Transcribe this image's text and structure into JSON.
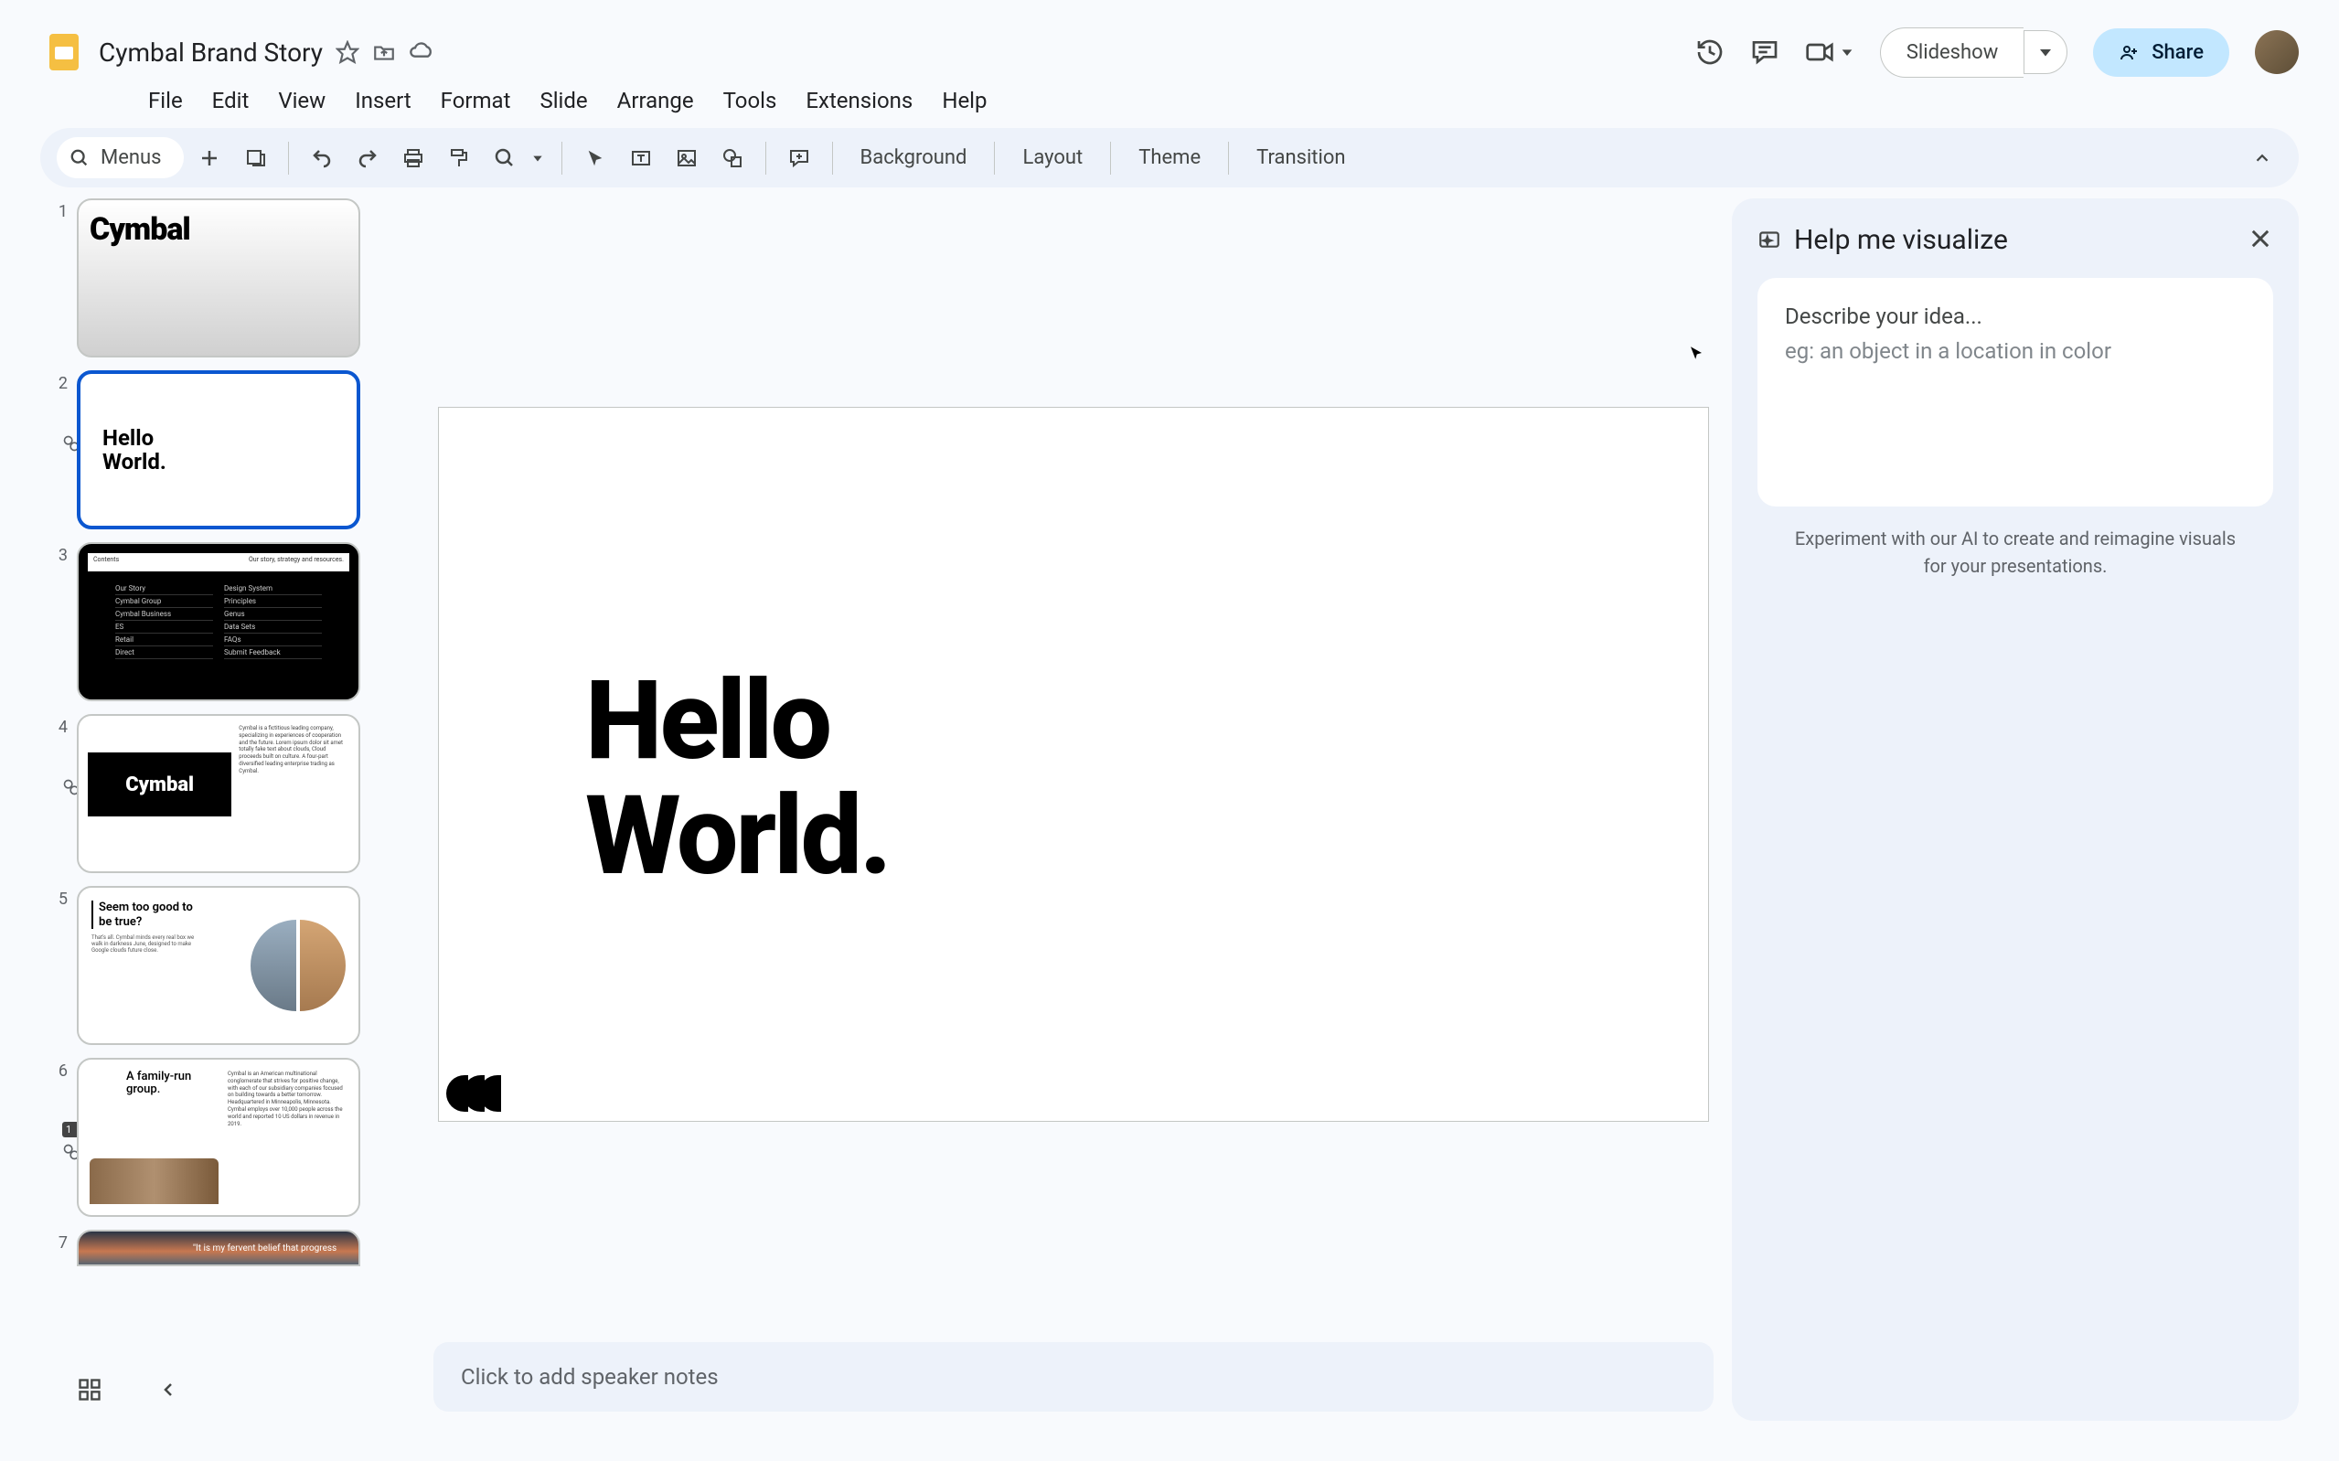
{
  "header": {
    "doc_title": "Cymbal Brand Story",
    "slideshow_label": "Slideshow",
    "share_label": "Share"
  },
  "menubar": {
    "items": [
      "File",
      "Edit",
      "View",
      "Insert",
      "Format",
      "Slide",
      "Arrange",
      "Tools",
      "Extensions",
      "Help"
    ]
  },
  "toolbar": {
    "menus_label": "Menus",
    "text_buttons": [
      "Background",
      "Layout",
      "Theme",
      "Transition"
    ]
  },
  "filmstrip": {
    "slides": [
      {
        "num": "1",
        "brand": "Cymbal"
      },
      {
        "num": "2",
        "line1": "Hello",
        "line2": "World."
      },
      {
        "num": "3",
        "top_left": "Contents",
        "top_right": "Our story, strategy and resources.",
        "col1": [
          "Our Story",
          "Cymbal Group",
          "Cymbal Business",
          "ES",
          "Retail",
          "Direct"
        ],
        "col2": [
          "Design System",
          "Principles",
          "Genus",
          "Data Sets",
          "FAQs",
          "Submit Feedback"
        ]
      },
      {
        "num": "4",
        "brand": "Cymbal"
      },
      {
        "num": "5",
        "title": "Seem too good to be true?"
      },
      {
        "num": "6",
        "title": "A family-run group."
      },
      {
        "num": "7",
        "quote": "\"It is my fervent belief that progress"
      }
    ]
  },
  "canvas": {
    "line1": "Hello",
    "line2": "World."
  },
  "speaker_notes": {
    "placeholder": "Click to add speaker notes"
  },
  "side_panel": {
    "title": "Help me visualize",
    "input_label": "Describe your idea...",
    "input_hint": "eg: an object in a location in color",
    "experiment_text": "Experiment with our AI to create and reimagine visuals for your presentations."
  }
}
